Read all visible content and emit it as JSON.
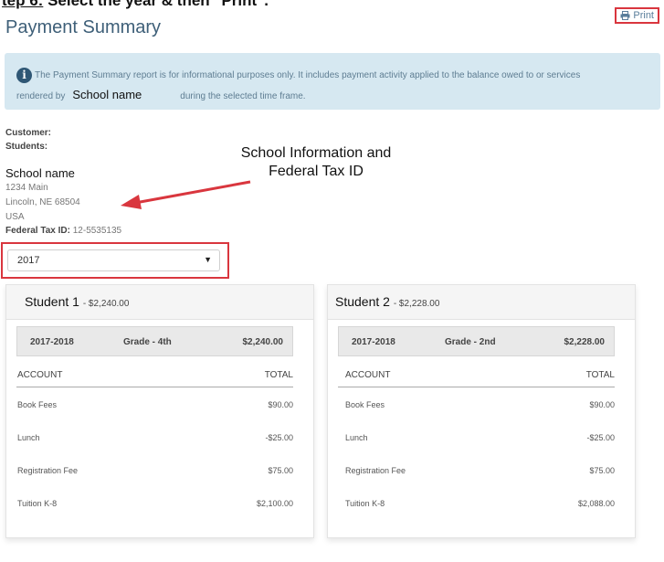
{
  "step_title": {
    "underlined": "tep 6:",
    "rest": " Select the year & then \"Print\"."
  },
  "page_title": "Payment Summary",
  "print_label": "Print",
  "info": {
    "line1": "The Payment Summary report is for informational purposes only. It includes payment activity applied to the balance owed to or services",
    "line2_prefix": "rendered by",
    "school_name": "School name",
    "line2_suffix": "during the selected time frame."
  },
  "customer_label": "Customer:",
  "students_label": "Students:",
  "school": {
    "name": "School name",
    "address1": "1234 Main",
    "address2": "Lincoln, NE 68504",
    "country": "USA",
    "tax_label": "Federal Tax ID:",
    "tax_id": "12-5535135"
  },
  "annotation": {
    "line1": "School Information and",
    "line2": "Federal Tax ID"
  },
  "year_select": {
    "value": "2017"
  },
  "colors": {
    "accent_red": "#d9363e",
    "info_bg": "#d6e8f1",
    "title_blue": "#3e5f78"
  },
  "cards": [
    {
      "student": "Student 1",
      "amount": "- $2,240.00",
      "year": "2017-2018",
      "grade": "Grade - 4th",
      "total": "$2,240.00",
      "account_header": "ACCOUNT",
      "total_header": "TOTAL",
      "rows": [
        {
          "account": "Book Fees",
          "total": "$90.00"
        },
        {
          "account": "Lunch",
          "total": "-$25.00"
        },
        {
          "account": "Registration Fee",
          "total": "$75.00"
        },
        {
          "account": "Tuition K-8",
          "total": "$2,100.00"
        }
      ]
    },
    {
      "student": "Student 2",
      "amount": "- $2,228.00",
      "year": "2017-2018",
      "grade": "Grade - 2nd",
      "total": "$2,228.00",
      "account_header": "ACCOUNT",
      "total_header": "TOTAL",
      "rows": [
        {
          "account": "Book Fees",
          "total": "$90.00"
        },
        {
          "account": "Lunch",
          "total": "-$25.00"
        },
        {
          "account": "Registration Fee",
          "total": "$75.00"
        },
        {
          "account": "Tuition K-8",
          "total": "$2,088.00"
        }
      ]
    }
  ]
}
